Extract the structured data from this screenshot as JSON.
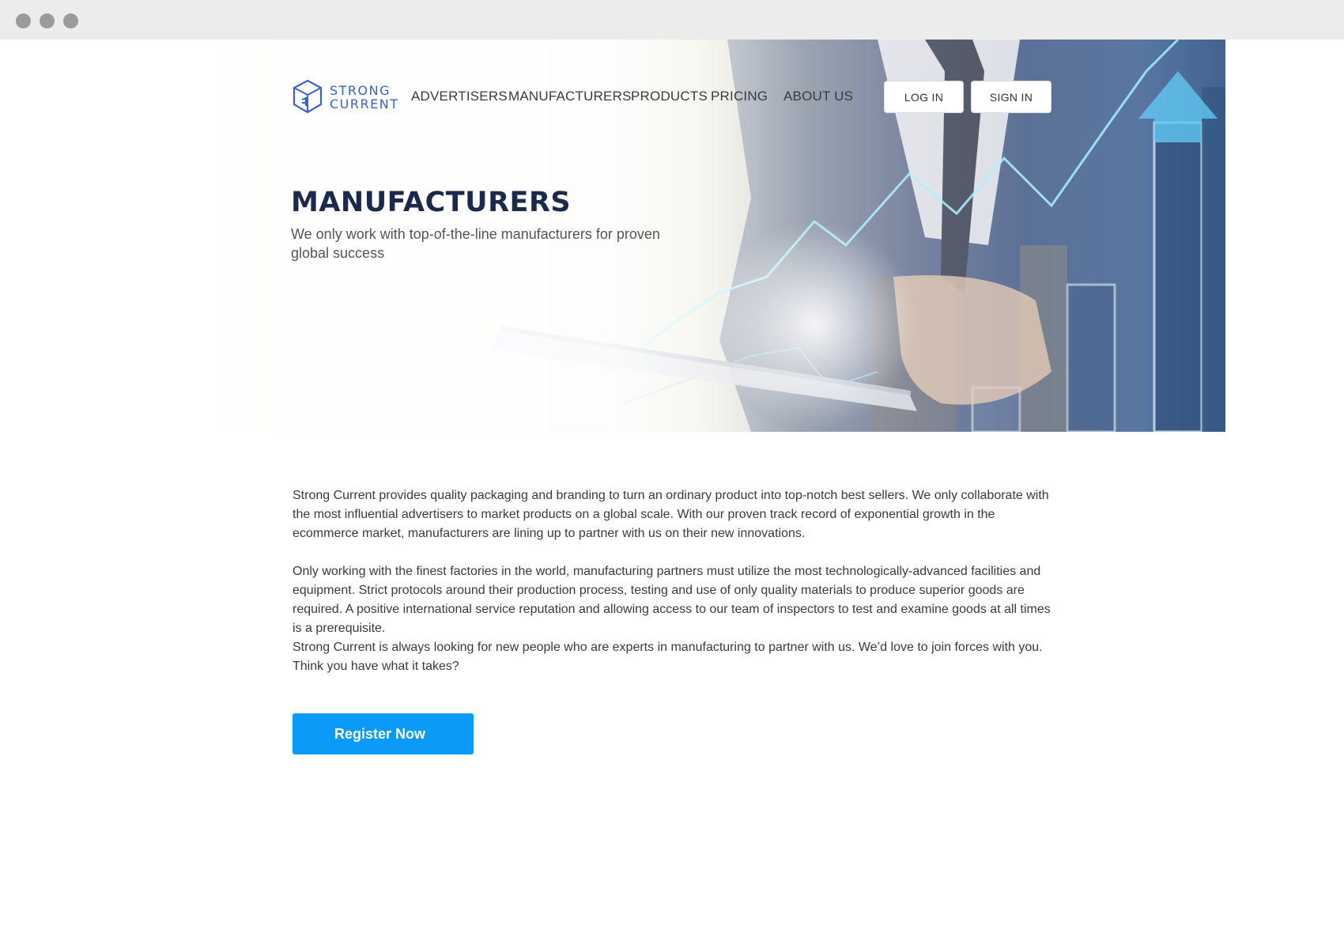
{
  "brand": {
    "name_line1": "STRONG",
    "name_line2": "CURRENT",
    "logo_color": "#3a62c9"
  },
  "nav": {
    "items": [
      {
        "label": "ADVERTISERS"
      },
      {
        "label": "MANUFACTURERS"
      },
      {
        "label": "PRODUCTS"
      },
      {
        "label": "PRICING"
      },
      {
        "label": "ABOUT US"
      }
    ],
    "login_label": "LOG IN",
    "signin_label": "SIGN IN"
  },
  "hero": {
    "title": "MANUFACTURERS",
    "subtitle": "We only work with top-of-the-line manufacturers for proven global success",
    "title_color": "#1b2a4c"
  },
  "body": {
    "paragraphs": [
      "Strong Current provides quality packaging and branding to turn an ordinary product into top-notch best sellers.  We only collaborate with the most influential advertisers to market products on a global scale. With our proven track record of exponential growth in the ecommerce market, manufacturers are lining up to partner with us on their new innovations.",
      "Only working with the finest factories in the world, manufacturing partners must utilize the most technologically-advanced facilities and equipment. Strict protocols around their production process, testing and use of only quality materials to produce superior goods are required.  A positive international service reputation and allowing access to our team of inspectors to test and examine goods at all times is a prerequisite.",
      "Strong Current is always looking for new people who are experts in manufacturing to partner with us. We’d love to join forces with you. Think you have what it takes?"
    ]
  },
  "cta": {
    "label": "Register Now",
    "color": "#0b9af7"
  },
  "window": {
    "icons": [
      "window-dot-icon",
      "window-dot-icon",
      "window-dot-icon"
    ]
  }
}
